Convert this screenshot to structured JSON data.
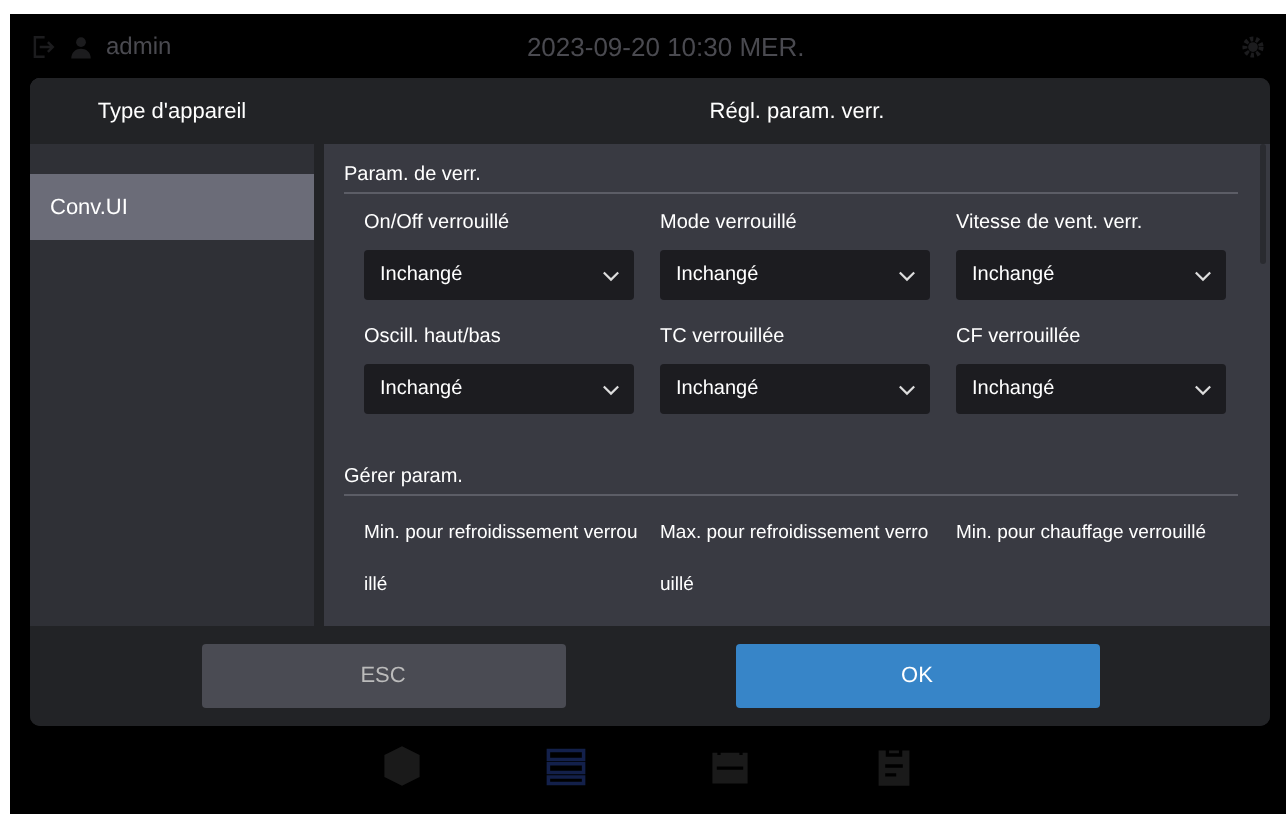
{
  "top_bar": {
    "user": "admin",
    "datetime": "2023-09-20 10:30 MER."
  },
  "dialog": {
    "sidebar": {
      "title": "Type d'appareil",
      "items": [
        {
          "label": "Conv.UI",
          "selected": true
        }
      ]
    },
    "title": "Régl. param. verr.",
    "sections": [
      {
        "title": "Param. de verr.",
        "fields": [
          {
            "kind": "select",
            "label": "On/Off verrouillé",
            "value": "Inchangé"
          },
          {
            "kind": "select",
            "label": "Mode verrouillé",
            "value": "Inchangé"
          },
          {
            "kind": "select",
            "label": "Vitesse de vent. verr.",
            "value": "Inchangé"
          },
          {
            "kind": "select",
            "label": "Oscill. haut/bas",
            "value": "Inchangé"
          },
          {
            "kind": "select",
            "label": "TC verrouillée",
            "value": "Inchangé"
          },
          {
            "kind": "select",
            "label": "CF verrouillée",
            "value": "Inchangé"
          }
        ]
      },
      {
        "title": "Gérer param.",
        "fields": [
          {
            "kind": "label",
            "label": "Min. pour refroidissement verrouillé"
          },
          {
            "kind": "label",
            "label": "Max. pour refroidissement verrouillé"
          },
          {
            "kind": "label",
            "label": "Min. pour chauffage verrouillé"
          }
        ]
      }
    ],
    "buttons": [
      {
        "label": "ESC",
        "kind": "secondary"
      },
      {
        "label": "OK",
        "kind": "primary"
      }
    ]
  },
  "bottom_nav": [
    {
      "kind": "cube",
      "selected": false
    },
    {
      "kind": "list",
      "selected": true
    },
    {
      "kind": "calendar",
      "selected": false
    },
    {
      "kind": "clipboard",
      "selected": false
    }
  ]
}
